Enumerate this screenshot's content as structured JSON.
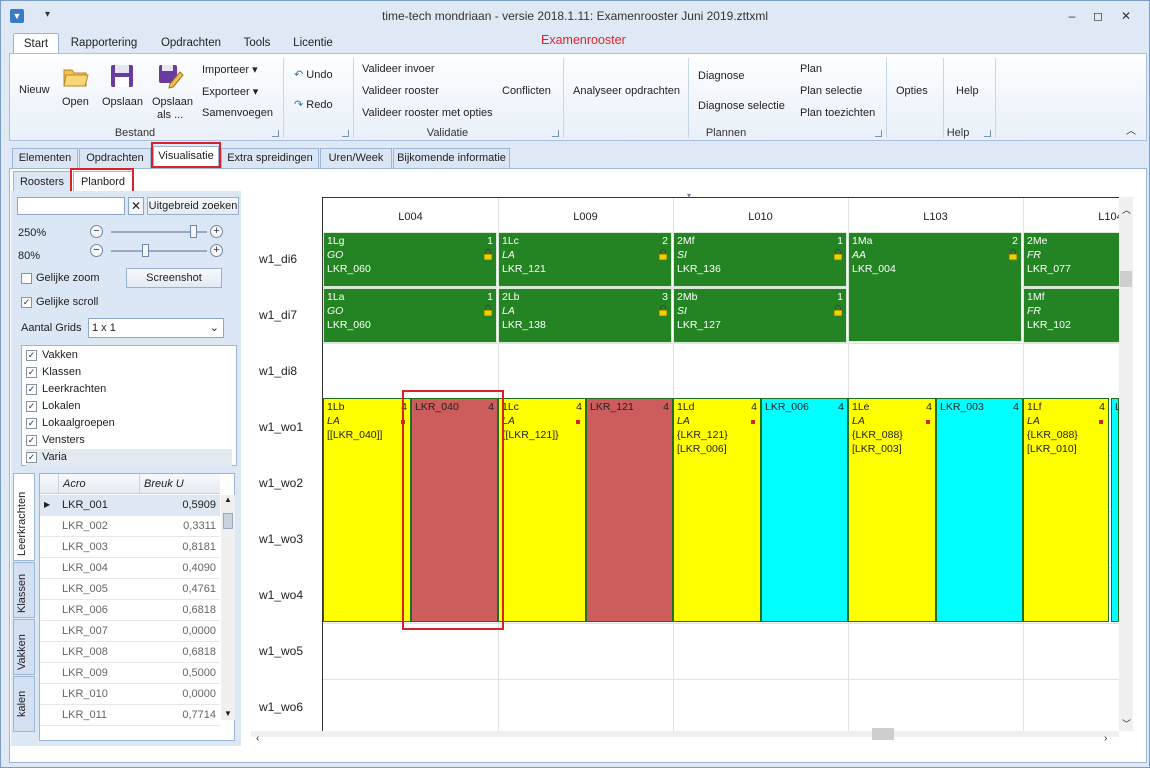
{
  "window": {
    "title": "time-tech mondriaan - versie 2018.1.11: Examenrooster Juni 2019.zttxml",
    "min": "–",
    "max": "◻",
    "close": "✕",
    "quickmenu": "▾"
  },
  "menu": {
    "tabs": [
      "Start",
      "Rapportering",
      "Opdrachten",
      "Tools",
      "Licentie"
    ],
    "context_label": "Examenrooster"
  },
  "ribbon": {
    "new": "Nieuw",
    "open": "Open",
    "save": "Opslaan",
    "saveas1": "Opslaan",
    "saveas2": "als ...",
    "import": "Importeer",
    "export": "Exporteer",
    "merge": "Samenvoegen",
    "group_file": "Bestand",
    "undo": "Undo",
    "redo": "Redo",
    "validate_input": "Valideer invoer",
    "validate_schedule": "Valideer rooster",
    "validate_opts": "Valideer rooster met opties",
    "conflicts": "Conflicten",
    "group_validate": "Validatie",
    "analyse": "Analyseer opdrachten",
    "diagnose": "Diagnose",
    "diagnose_sel": "Diagnose selectie",
    "plan": "Plan",
    "plan_sel": "Plan selectie",
    "plan_super": "Plan toezichten",
    "group_plan": "Plannen",
    "options": "Opties",
    "help": "Help",
    "group_help": "Help"
  },
  "tabs": [
    "Elementen",
    "Opdrachten",
    "Visualisatie",
    "Extra spreidingen",
    "Uren/Week",
    "Bijkomende informatie"
  ],
  "subtabs": [
    "Roosters",
    "Planbord"
  ],
  "left": {
    "search_placeholder": "",
    "clear": "✕",
    "advanced": "Uitgebreid zoeken",
    "zoom1": "250%",
    "zoom1_level": 0.85,
    "zoom2": "80%",
    "zoom2_level": 0.35,
    "equal_zoom": "Gelijke zoom",
    "screenshot": "Screenshot",
    "equal_scroll": "Gelijke scroll",
    "grids_label": "Aantal Grids",
    "grids_value": "1 x 1",
    "layers": [
      "Vakken",
      "Klassen",
      "Leerkrachten",
      "Lokalen",
      "Lokaalgroepen",
      "Vensters",
      "Varia"
    ],
    "vtabs": [
      "Leerkrachten",
      "Klassen",
      "Vakken",
      "kalen"
    ],
    "grid_headers": [
      "Acro",
      "Breuk U"
    ],
    "rows": [
      [
        "LKR_001",
        "0,5909"
      ],
      [
        "LKR_002",
        "0,3311"
      ],
      [
        "LKR_003",
        "0,8181"
      ],
      [
        "LKR_004",
        "0,4090"
      ],
      [
        "LKR_005",
        "0,4761"
      ],
      [
        "LKR_006",
        "0,6818"
      ],
      [
        "LKR_007",
        "0,0000"
      ],
      [
        "LKR_008",
        "0,6818"
      ],
      [
        "LKR_009",
        "0,5000"
      ],
      [
        "LKR_010",
        "0,0000"
      ],
      [
        "LKR_011",
        "0,7714"
      ]
    ]
  },
  "planner": {
    "columns": [
      "L004",
      "L009",
      "L010",
      "L103",
      "L104"
    ],
    "rows": [
      "w1_di6",
      "w1_di7",
      "w1_di8",
      "w1_wo1",
      "w1_wo2",
      "w1_wo3",
      "w1_wo4",
      "w1_wo5",
      "w1_wo6"
    ],
    "green_cells": [
      {
        "l1": "1Lg",
        "num": "1",
        "l2": "GO",
        "l3": "LKR_060"
      },
      {
        "l1": "1Lc",
        "num": "2",
        "l2": "LA",
        "l3": "LKR_121"
      },
      {
        "l1": "2Mf",
        "num": "1",
        "l2": "SI",
        "l3": "LKR_136"
      },
      {
        "l1": "1Ma",
        "num": "2",
        "l2": "AA",
        "l3": "LKR_004"
      },
      {
        "l1": "2Me",
        "num": "",
        "l2": "FR",
        "l3": "LKR_077"
      },
      {
        "l1": "1La",
        "num": "1",
        "l2": "GO",
        "l3": "LKR_060"
      },
      {
        "l1": "2Lb",
        "num": "3",
        "l2": "LA",
        "l3": "LKR_138"
      },
      {
        "l1": "2Mb",
        "num": "1",
        "l2": "SI",
        "l3": "LKR_127"
      },
      {
        "l1": "1Mf",
        "num": "",
        "l2": "FR",
        "l3": "LKR_102"
      }
    ],
    "wo_cells": [
      {
        "l1": "1Lb",
        "num": "4",
        "l2": "LA",
        "l3": "[[LKR_040]]",
        "l4": ""
      },
      {
        "l1": "LKR_040",
        "num": "4",
        "l2": "",
        "l3": "",
        "l4": ""
      },
      {
        "l1": "1Lc",
        "num": "4",
        "l2": "LA",
        "l3": "{[LKR_121]}",
        "l4": ""
      },
      {
        "l1": "LKR_121",
        "num": "4",
        "l2": "",
        "l3": "",
        "l4": ""
      },
      {
        "l1": "1Ld",
        "num": "4",
        "l2": "LA",
        "l3": "{LKR_121}",
        "l4": "[LKR_006]"
      },
      {
        "l1": "LKR_006",
        "num": "4",
        "l2": "",
        "l3": "",
        "l4": ""
      },
      {
        "l1": "1Le",
        "num": "4",
        "l2": "LA",
        "l3": "{LKR_088}",
        "l4": "[LKR_003]"
      },
      {
        "l1": "LKR_003",
        "num": "4",
        "l2": "",
        "l3": "",
        "l4": ""
      },
      {
        "l1": "1Lf",
        "num": "4",
        "l2": "LA",
        "l3": "{LKR_088}",
        "l4": "[LKR_010]"
      },
      {
        "l1": "L",
        "num": "",
        "l2": "",
        "l3": "",
        "l4": ""
      }
    ]
  },
  "colors": {
    "green": "#248424",
    "yellow": "#ffff00",
    "red": "#cd5c5c",
    "cyan": "#00ffff",
    "highlight": "#d8222a"
  }
}
